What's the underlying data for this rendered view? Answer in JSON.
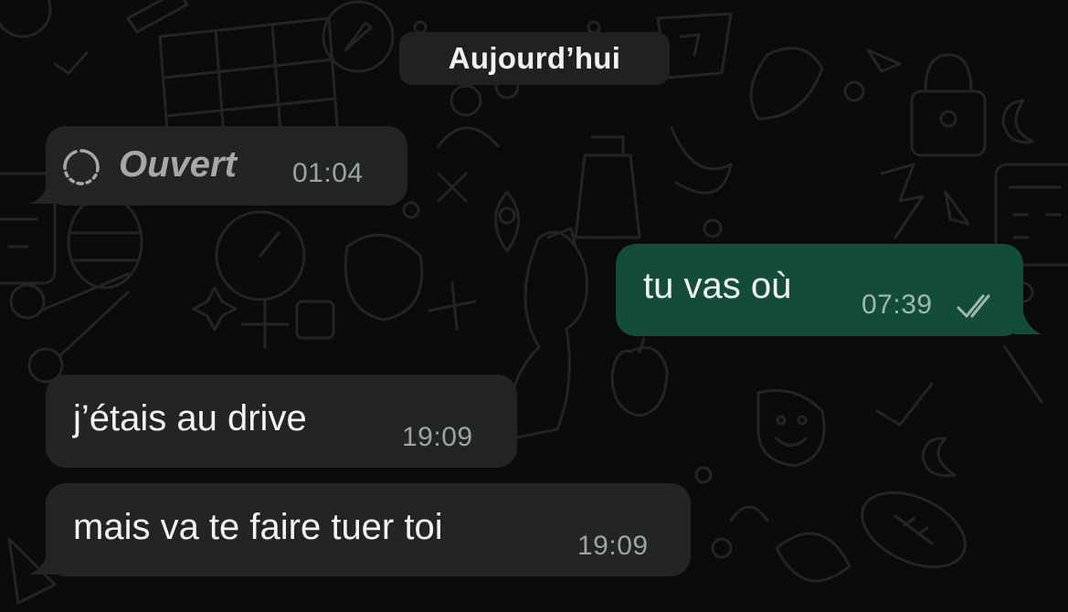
{
  "date_separator": "Aujourd’hui",
  "messages": [
    {
      "direction": "incoming",
      "kind": "view-once",
      "status_label": "Ouvert",
      "status_icon": "view-once-opened-icon",
      "time": "01:04"
    },
    {
      "direction": "outgoing",
      "text": "tu vas où",
      "time": "07:39",
      "receipt_icon": "double-check-icon"
    },
    {
      "direction": "incoming",
      "text": "j’étais au drive",
      "time": "19:09"
    },
    {
      "direction": "incoming",
      "text": "mais va te faire tuer toi",
      "time": "19:09"
    }
  ],
  "colors": {
    "background": "#0b0b0b",
    "incoming_bubble": "#232524",
    "outgoing_bubble": "#134d37",
    "date_pill": "#1f2221"
  }
}
